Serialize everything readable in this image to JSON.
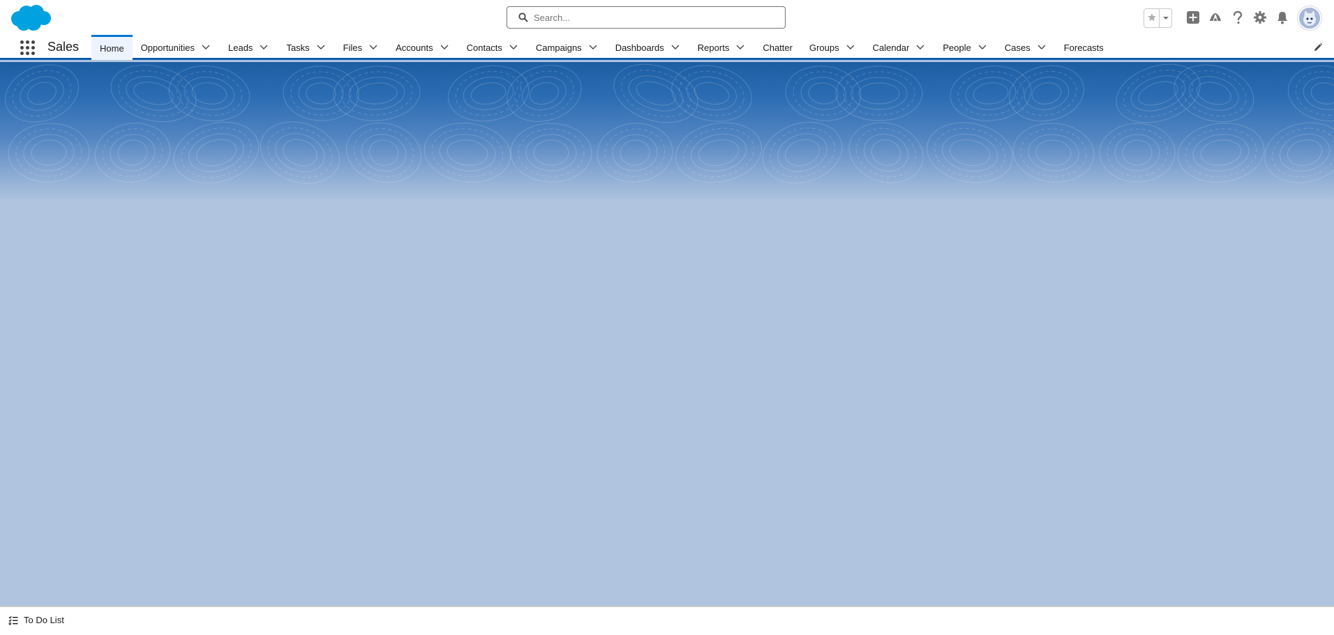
{
  "app": {
    "name": "Sales"
  },
  "search": {
    "placeholder": "Search..."
  },
  "nav": {
    "items": [
      {
        "label": "Home",
        "active": true,
        "has_menu": false
      },
      {
        "label": "Opportunities",
        "has_menu": true
      },
      {
        "label": "Leads",
        "has_menu": true
      },
      {
        "label": "Tasks",
        "has_menu": true
      },
      {
        "label": "Files",
        "has_menu": true
      },
      {
        "label": "Accounts",
        "has_menu": true
      },
      {
        "label": "Contacts",
        "has_menu": true
      },
      {
        "label": "Campaigns",
        "has_menu": true
      },
      {
        "label": "Dashboards",
        "has_menu": true
      },
      {
        "label": "Reports",
        "has_menu": true
      },
      {
        "label": "Chatter",
        "has_menu": false
      },
      {
        "label": "Groups",
        "has_menu": true
      },
      {
        "label": "Calendar",
        "has_menu": true
      },
      {
        "label": "People",
        "has_menu": true
      },
      {
        "label": "Cases",
        "has_menu": true
      },
      {
        "label": "Forecasts",
        "has_menu": false
      }
    ]
  },
  "header_icons": [
    "star-icon",
    "chevron-down-icon",
    "plus-icon",
    "trailhead-icon",
    "help-icon",
    "gear-icon",
    "bell-icon",
    "avatar"
  ],
  "utility": {
    "todo_label": "To Do List"
  },
  "colors": {
    "brand": "#0176d3",
    "banner_top": "#1d5ea3",
    "page_bg": "#b0c4df",
    "nav_underline": "#0b5cab"
  }
}
